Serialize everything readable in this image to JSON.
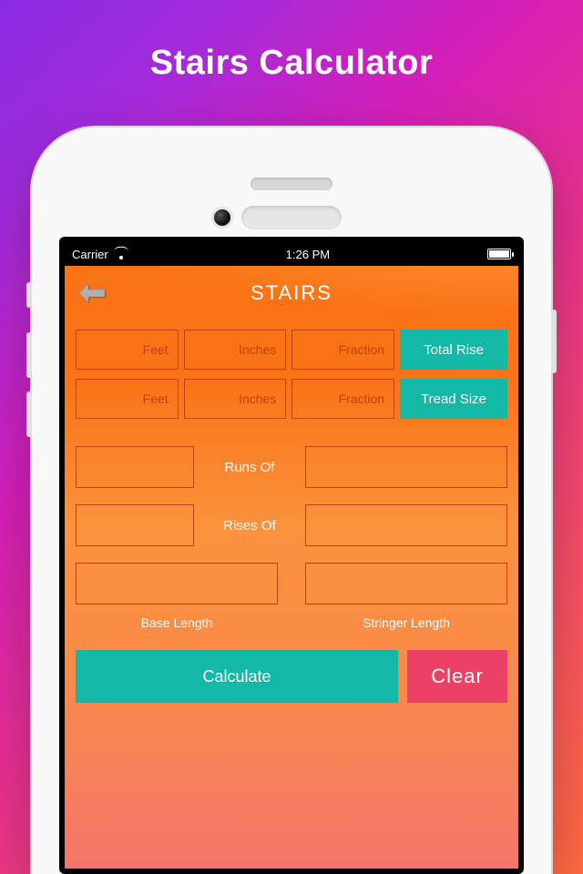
{
  "promo": {
    "title": "Stairs Calculator"
  },
  "statusbar": {
    "carrier": "Carrier",
    "time": "1:26 PM"
  },
  "header": {
    "title": "STAIRS"
  },
  "inputs": {
    "row1": {
      "feet": "Feet",
      "inches": "Inches",
      "fraction": "Fraction",
      "chip": "Total Rise"
    },
    "row2": {
      "feet": "Feet",
      "inches": "Inches",
      "fraction": "Fraction",
      "chip": "Tread Size"
    }
  },
  "mid": {
    "runs_label": "Runs Of",
    "rises_label": "Rises Of"
  },
  "bottom": {
    "base_label": "Base Length",
    "stringer_label": "Stringer Length"
  },
  "actions": {
    "calculate": "Calculate",
    "clear": "Clear"
  }
}
